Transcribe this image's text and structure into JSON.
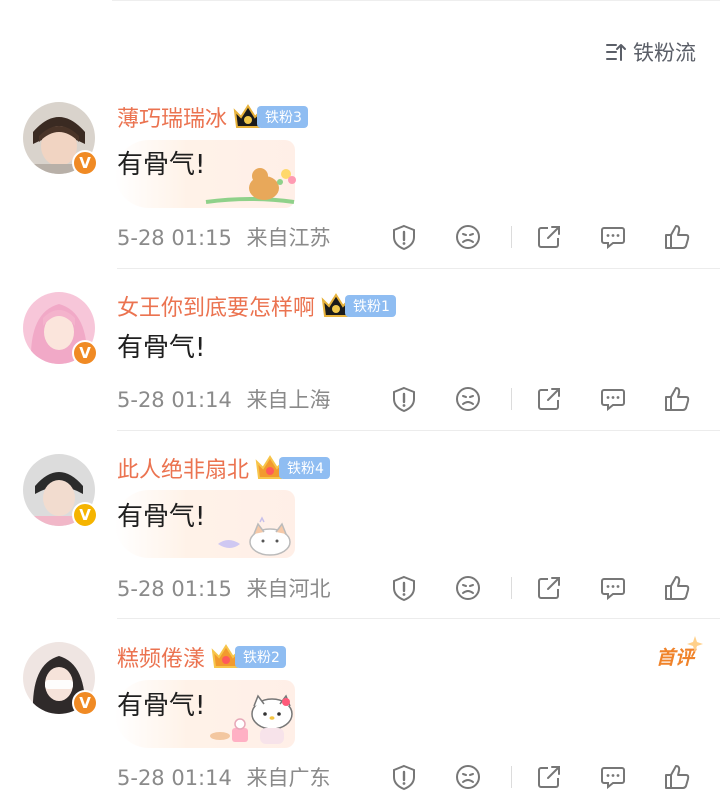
{
  "sort": {
    "label": "铁粉流"
  },
  "comments": [
    {
      "username": "薄巧瑞瑞冰",
      "fan_badge": "铁粉3",
      "text": "有骨气!",
      "time": "5-28 01:15",
      "location": "来自江苏",
      "verified": "V"
    },
    {
      "username": "女王你到底要怎样啊",
      "fan_badge": "铁粉1",
      "text": "有骨气!",
      "time": "5-28 01:14",
      "location": "来自上海",
      "verified": "V"
    },
    {
      "username": "此人绝非扇北",
      "fan_badge": "铁粉4",
      "text": "有骨气!",
      "time": "5-28 01:15",
      "location": "来自河北",
      "verified": "V"
    },
    {
      "username": "糕频倦漾",
      "fan_badge": "铁粉2",
      "text": "有骨气!",
      "time": "5-28 01:14",
      "location": "来自广东",
      "verified": "V",
      "first_comment_label": "首评"
    }
  ],
  "icons": {
    "report": "report-icon",
    "dislike": "sad-face-icon",
    "share": "share-icon",
    "reply": "comment-icon",
    "like": "thumbs-up-icon"
  },
  "colors": {
    "username": "#eb7350",
    "fan_badge": "#8fbdf2",
    "meta": "#8a8a8a",
    "verified_orange": "#f08a24",
    "verified_yellow": "#f5b400"
  }
}
